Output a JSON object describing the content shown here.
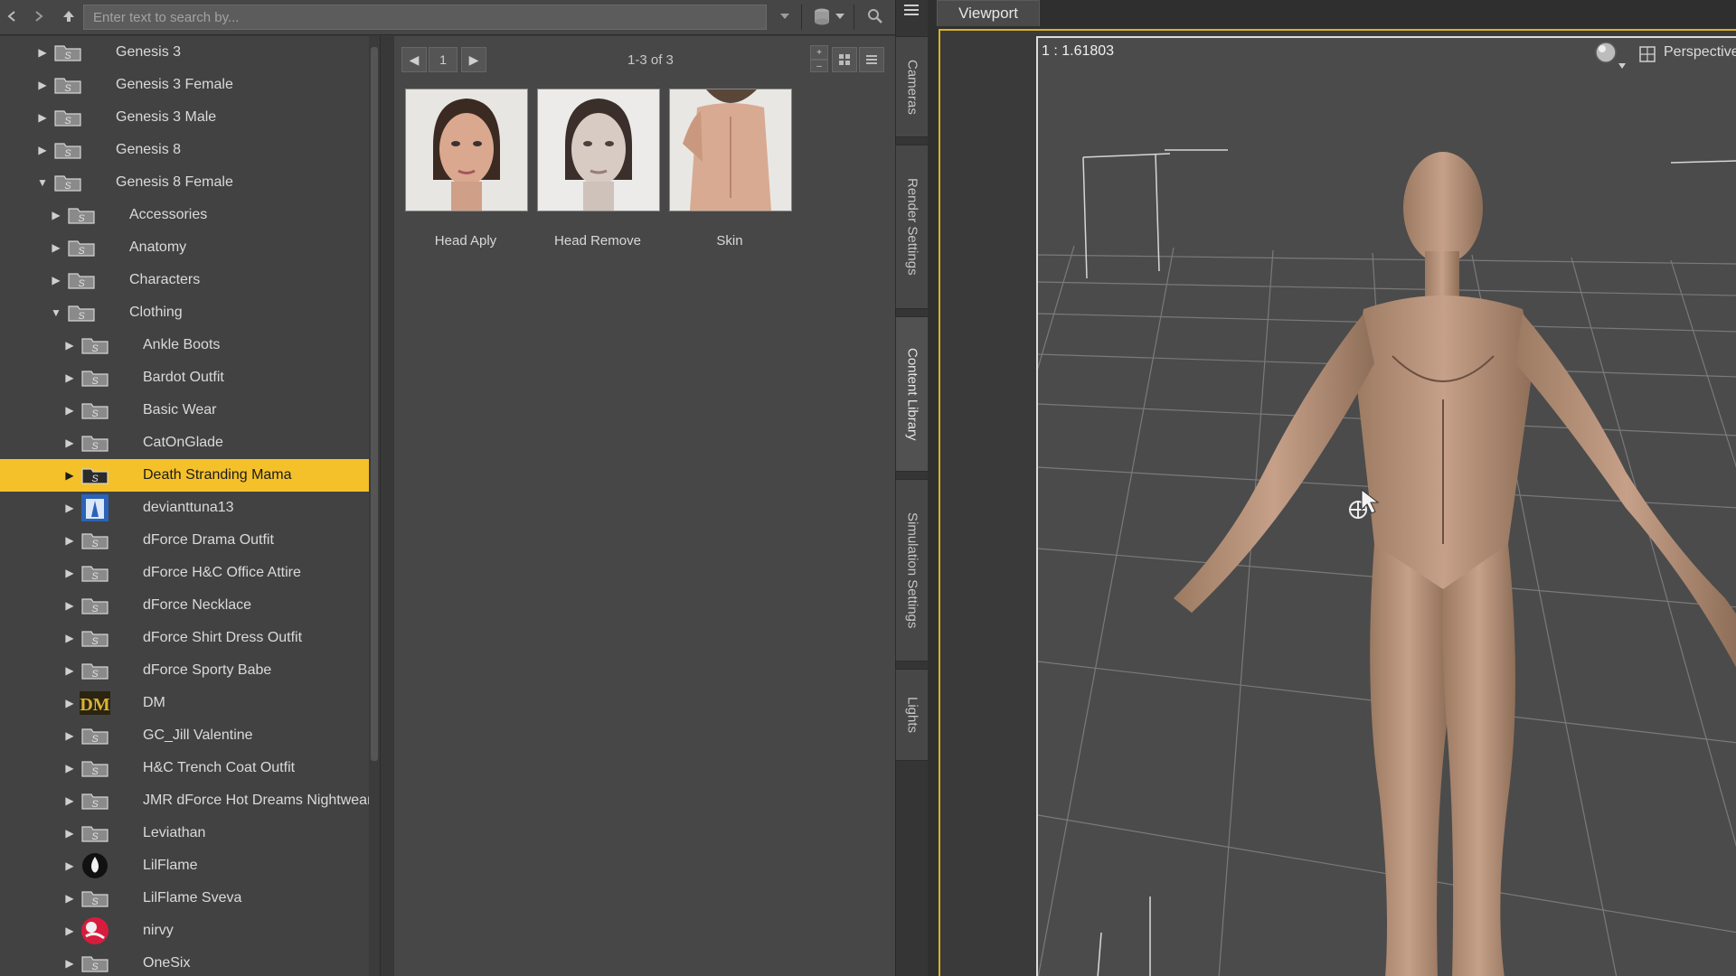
{
  "search": {
    "placeholder": "Enter text to search by..."
  },
  "icons": {
    "back": "back-arrow-icon",
    "forward": "forward-arrow-icon",
    "up": "up-arrow-icon",
    "dropdown": "chevron-down-icon",
    "database": "database-icon",
    "search": "search-icon",
    "menu": "menu-icon"
  },
  "tree": [
    {
      "label": "Genesis 3",
      "level": 0,
      "arrow": "▶",
      "icon": "folder"
    },
    {
      "label": "Genesis 3 Female",
      "level": 0,
      "arrow": "▶",
      "icon": "folder"
    },
    {
      "label": "Genesis 3 Male",
      "level": 0,
      "arrow": "▶",
      "icon": "folder"
    },
    {
      "label": "Genesis 8",
      "level": 0,
      "arrow": "▶",
      "icon": "folder"
    },
    {
      "label": "Genesis 8 Female",
      "level": 0,
      "arrow": "▼",
      "icon": "folder"
    },
    {
      "label": "Accessories",
      "level": 1,
      "arrow": "▶",
      "icon": "folder"
    },
    {
      "label": "Anatomy",
      "level": 1,
      "arrow": "▶",
      "icon": "folder"
    },
    {
      "label": "Characters",
      "level": 1,
      "arrow": "▶",
      "icon": "folder"
    },
    {
      "label": "Clothing",
      "level": 1,
      "arrow": "▼",
      "icon": "folder"
    },
    {
      "label": "Ankle Boots",
      "level": 2,
      "arrow": "▶",
      "icon": "folder"
    },
    {
      "label": "Bardot Outfit",
      "level": 2,
      "arrow": "▶",
      "icon": "folder"
    },
    {
      "label": "Basic Wear",
      "level": 2,
      "arrow": "▶",
      "icon": "folder"
    },
    {
      "label": "CatOnGlade",
      "level": 2,
      "arrow": "▶",
      "icon": "folder"
    },
    {
      "label": "Death Stranding Mama",
      "level": 2,
      "arrow": "▶",
      "icon": "folder",
      "selected": true
    },
    {
      "label": "devianttuna13",
      "level": 2,
      "arrow": "▶",
      "icon": "avatar-blue"
    },
    {
      "label": "dForce Drama Outfit",
      "level": 2,
      "arrow": "▶",
      "icon": "folder"
    },
    {
      "label": "dForce H&C Office Attire",
      "level": 2,
      "arrow": "▶",
      "icon": "folder"
    },
    {
      "label": "dForce Necklace",
      "level": 2,
      "arrow": "▶",
      "icon": "folder"
    },
    {
      "label": "dForce Shirt Dress Outfit",
      "level": 2,
      "arrow": "▶",
      "icon": "folder"
    },
    {
      "label": "dForce Sporty Babe",
      "level": 2,
      "arrow": "▶",
      "icon": "folder"
    },
    {
      "label": "DM",
      "level": 2,
      "arrow": "▶",
      "icon": "dm-logo"
    },
    {
      "label": "GC_Jill Valentine",
      "level": 2,
      "arrow": "▶",
      "icon": "folder"
    },
    {
      "label": "H&C Trench Coat Outfit",
      "level": 2,
      "arrow": "▶",
      "icon": "folder"
    },
    {
      "label": "JMR dForce Hot Dreams Nightwear",
      "level": 2,
      "arrow": "▶",
      "icon": "folder"
    },
    {
      "label": "Leviathan",
      "level": 2,
      "arrow": "▶",
      "icon": "folder"
    },
    {
      "label": "LilFlame",
      "level": 2,
      "arrow": "▶",
      "icon": "flame-logo"
    },
    {
      "label": "LilFlame Sveva",
      "level": 2,
      "arrow": "▶",
      "icon": "folder"
    },
    {
      "label": "nirvy",
      "level": 2,
      "arrow": "▶",
      "icon": "avatar-red"
    },
    {
      "label": "OneSix",
      "level": 2,
      "arrow": "▶",
      "icon": "folder"
    }
  ],
  "content": {
    "page": "1",
    "count": "1-3 of 3",
    "items": [
      {
        "label": "Head Aply",
        "thumb": "face"
      },
      {
        "label": "Head Remove",
        "thumb": "face-pale"
      },
      {
        "label": "Skin",
        "thumb": "back"
      }
    ]
  },
  "side_tabs": [
    "Cameras",
    "Render Settings",
    "Content Library",
    "Simulation Settings",
    "Lights"
  ],
  "side_tab_active": "Content Library",
  "viewport": {
    "tab": "Viewport",
    "ratio": "1 : 1.61803",
    "camera": "Perspective"
  },
  "colors": {
    "selection": "#f4c12b",
    "viewport_border": "#d8b226"
  }
}
